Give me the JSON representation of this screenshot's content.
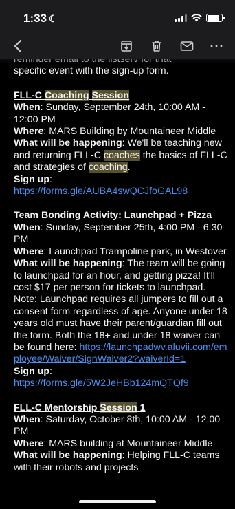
{
  "status_bar": {
    "time": "1:33",
    "moon_glyph": "☾"
  },
  "nav": {
    "back_icon": "chevron-left-icon",
    "more_glyph": "···"
  },
  "intro": {
    "cut_line": "reminder email to the listserv for that",
    "line": "specific event with the sign-up form."
  },
  "events": [
    {
      "title_a": "FLL-C ",
      "title_hl1": "Coaching",
      "title_b": " ",
      "title_hl2": "Session",
      "when_label": "When",
      "when": ": Sunday, September 24th, 10:00 AM - 12:00 PM",
      "where_label": "Where",
      "where": ": MARS Building by Mountaineer Middle",
      "what_label": "What will be happening",
      "what_a": ": We'll be teaching new and returning FLL-C ",
      "what_hl1": "coaches",
      "what_b": " the basics of FLL-C and strategies of ",
      "what_hl2": "coaching",
      "what_c": ".",
      "signup_label": "Sign up",
      "signup_sep": ": ",
      "signup_link": "https://forms.gle/AUBA4swQCJfoGAL98"
    },
    {
      "title": "Team Bonding Activity: Launchpad + Pizza",
      "when_label": "When",
      "when": ": Sunday, September 25th, 4:00 PM - 6:30 PM",
      "where_label": "Where",
      "where": ": Launchpad Trampoline park, in Westover",
      "what_label": "What will be happening",
      "what": ": The team will be going to launchpad for an hour, and getting pizza! It'll cost $17 per person for tickets to launchpad. Note: Launchpad requires all jumpers to fill out a consent form regardless of age. Anyone under 18 years old must have their parent/guardian fill out the form. Both the 18+ and under 18 waiver can be found here: ",
      "waiver_link": "https://launchpadwv.aluvii.com/employee/Waiver/SignWaiver2?waiverId=1",
      "signup_label": "Sign up",
      "signup_sep": ": ",
      "signup_link": "https://forms.gle/5W2JeHBb124mQTQf9"
    },
    {
      "title_a": "FLL-C Mentorship ",
      "title_hl": "Session",
      "title_b": " 1",
      "when_label": "When",
      "when": ": Saturday, October 8th, 10:00 AM - 12:00 PM",
      "where_label": "Where",
      "where": ": MARS building at Mountaineer Middle",
      "what_label": "What will be happening",
      "what": ": Helping FLL-C teams with their robots and projects"
    }
  ]
}
